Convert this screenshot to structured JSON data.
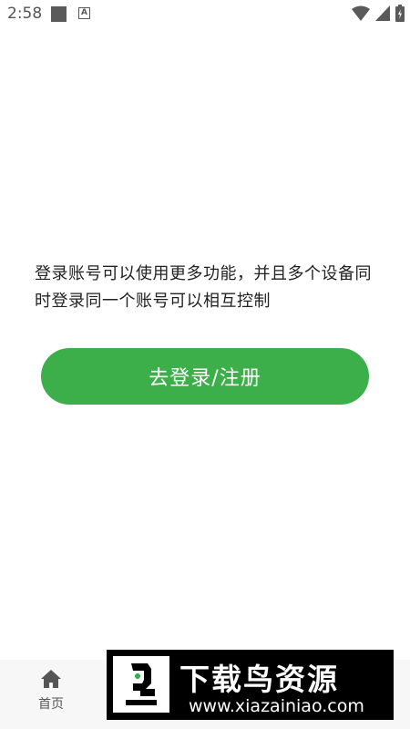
{
  "status_bar": {
    "time": "2:58",
    "notification_badge": "A"
  },
  "main": {
    "message": "登录账号可以使用更多功能，并且多个设备同时登录同一个账号可以相互控制",
    "login_button_label": "去登录/注册",
    "accent_color": "#3cae4a"
  },
  "bottom_nav": {
    "home_label": "首页",
    "home_icon": "home-icon"
  },
  "watermark": {
    "title": "下载鸟资源",
    "url": "www.xiazainiao.com"
  }
}
